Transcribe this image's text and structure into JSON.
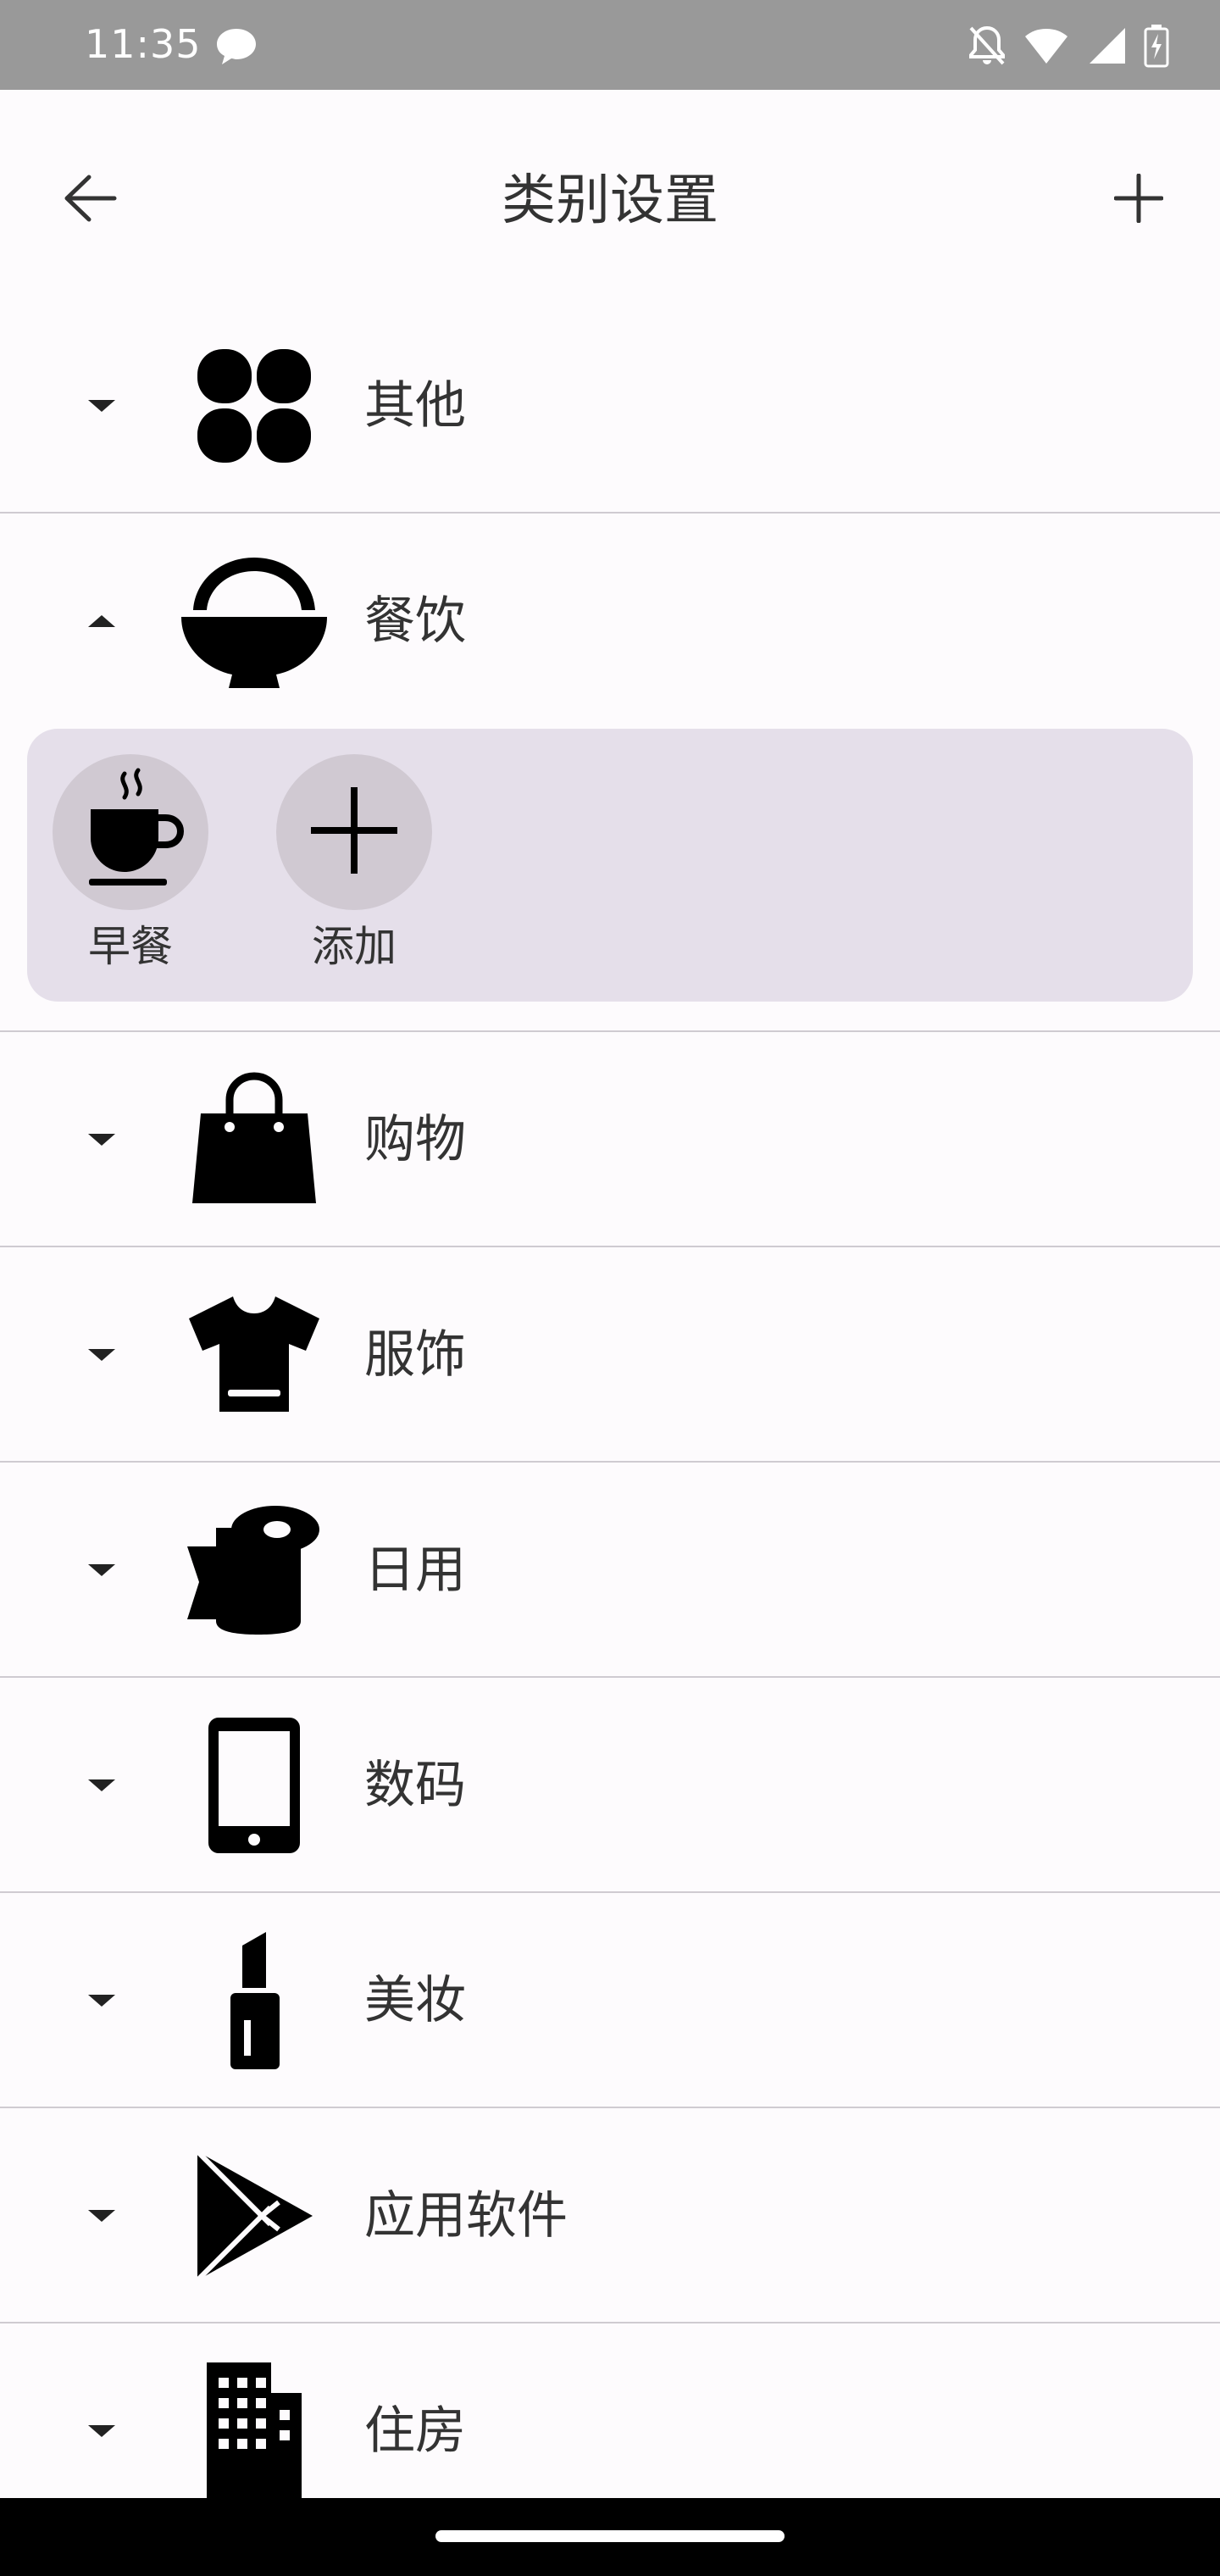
{
  "status_bar": {
    "time": "11:35",
    "icons": [
      "message-icon",
      "bell-off-icon",
      "wifi-icon",
      "signal-icon",
      "battery-charging-icon"
    ]
  },
  "app_bar": {
    "title": "类别设置",
    "back_icon": "arrow-left-icon",
    "add_icon": "plus-icon"
  },
  "categories": [
    {
      "label": "其他",
      "icon": "clover-icon",
      "expanded": false
    },
    {
      "label": "餐饮",
      "icon": "rice-bowl-icon",
      "expanded": true,
      "subcategories": [
        {
          "label": "早餐",
          "icon": "coffee-cup-icon"
        },
        {
          "label": "添加",
          "icon": "plus-icon"
        }
      ]
    },
    {
      "label": "购物",
      "icon": "shopping-bag-icon",
      "expanded": false
    },
    {
      "label": "服饰",
      "icon": "t-shirt-icon",
      "expanded": false
    },
    {
      "label": "日用",
      "icon": "tissue-roll-icon",
      "expanded": false
    },
    {
      "label": "数码",
      "icon": "smartphone-icon",
      "expanded": false
    },
    {
      "label": "美妆",
      "icon": "lipstick-icon",
      "expanded": false
    },
    {
      "label": "应用软件",
      "icon": "play-store-icon",
      "expanded": false
    },
    {
      "label": "住房",
      "icon": "building-icon",
      "expanded": false
    }
  ],
  "colors": {
    "background": "#fdfbfd",
    "status_bar": "#999999",
    "sub_panel": "#e5dfea",
    "sub_circle": "#d0c9d2",
    "divider": "#cfcbd1"
  }
}
